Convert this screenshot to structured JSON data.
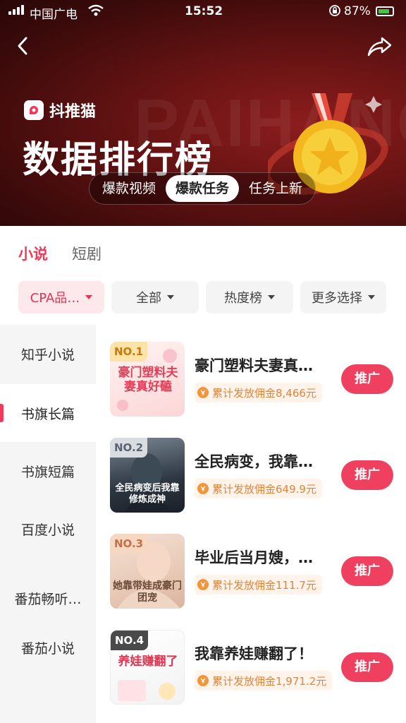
{
  "status_bar": {
    "carrier": "中国广电",
    "time": "15:52",
    "battery": "87%"
  },
  "header": {
    "brand_name": "抖推猫",
    "watermark": "PAIHANG",
    "title": "数据排行榜",
    "tabs": [
      {
        "label": "爆款视频",
        "active": false
      },
      {
        "label": "爆款任务",
        "active": true
      },
      {
        "label": "任务上新",
        "active": false
      }
    ]
  },
  "category_tabs": [
    {
      "label": "小说",
      "active": true
    },
    {
      "label": "短剧",
      "active": false
    }
  ],
  "filters": [
    {
      "label": "CPA品…",
      "active": true
    },
    {
      "label": "全部",
      "active": false
    },
    {
      "label": "热度榜",
      "active": false
    },
    {
      "label": "更多选择",
      "active": false
    }
  ],
  "sidebar": {
    "items": [
      {
        "label": "知乎小说",
        "active": false
      },
      {
        "label": "书旗长篇",
        "active": true
      },
      {
        "label": "书旗短篇",
        "active": false
      },
      {
        "label": "百度小说",
        "active": false
      },
      {
        "label": "番茄畅听…",
        "active": false
      },
      {
        "label": "番茄小说",
        "active": false
      }
    ]
  },
  "list": {
    "promote_label": "推广",
    "items": [
      {
        "rank": "NO.1",
        "title": "豪门塑料夫妻真…",
        "commission": "累计发放佣金8,466元",
        "cover_text": "豪门塑料夫妻真好磕"
      },
      {
        "rank": "NO.2",
        "title": "全民病变，我靠…",
        "commission": "累计发放佣金649.9元",
        "cover_text": "全民病变后我靠修炼成神"
      },
      {
        "rank": "NO.3",
        "title": "毕业后当月嫂，…",
        "commission": "累计发放佣金111.7元",
        "cover_text": "她靠带娃成豪门团宠"
      },
      {
        "rank": "NO.4",
        "title": "我靠养娃赚翻了！",
        "commission": "累计发放佣金1,971.2元",
        "cover_text": "养娃赚翻了"
      }
    ]
  },
  "colors": {
    "accent": "#f03a5c",
    "hero_bg": "#5a1010",
    "commission": "#e0843c"
  }
}
